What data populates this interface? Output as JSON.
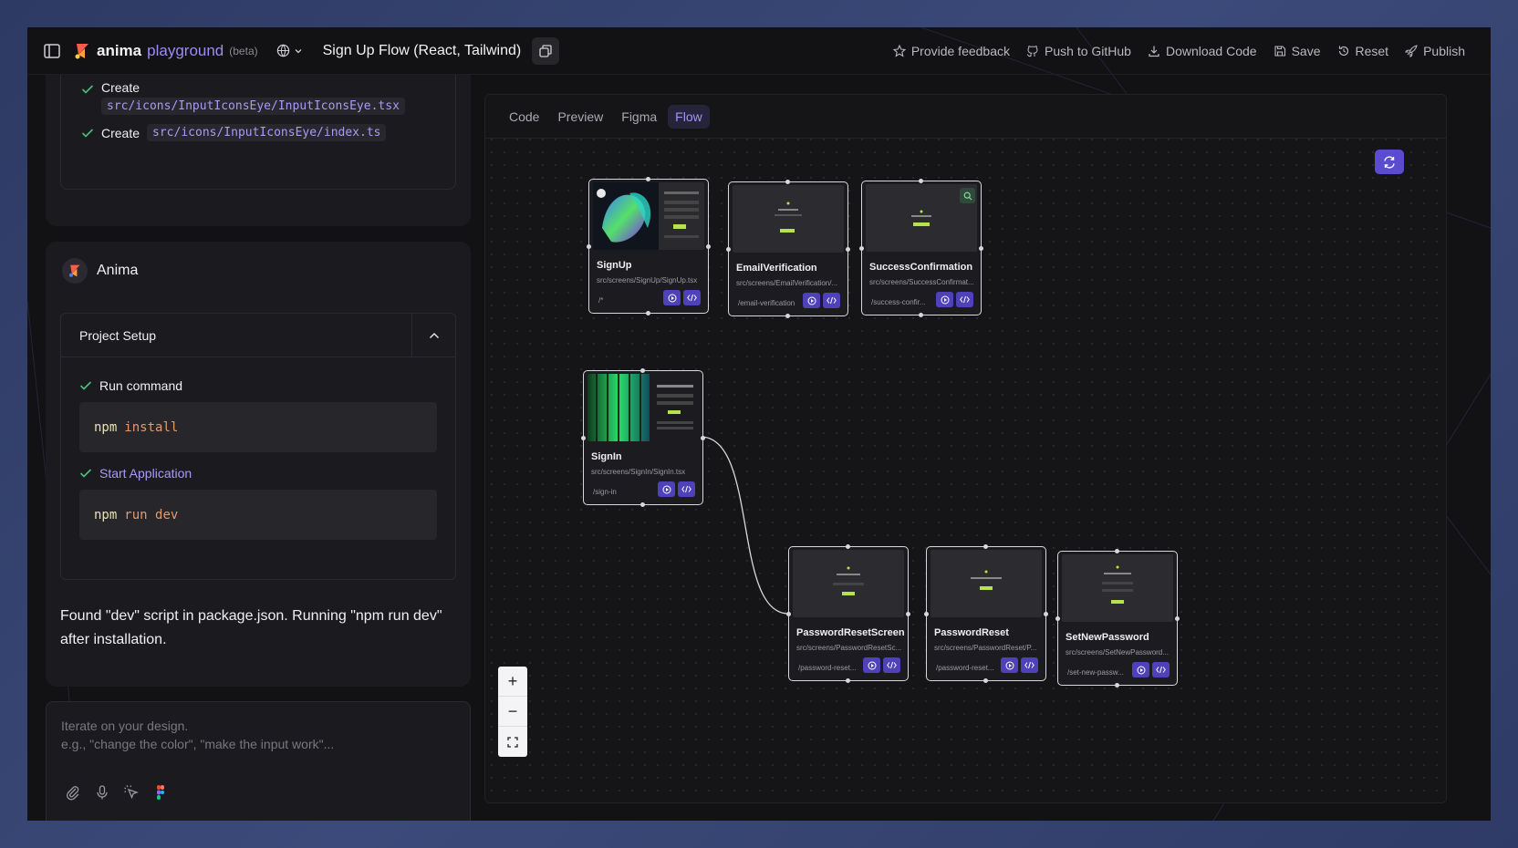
{
  "header": {
    "brand": "anima",
    "brand_sub": "playground",
    "beta": "(beta)",
    "project_title": "Sign Up Flow (React, Tailwind)",
    "actions": [
      {
        "label": "Provide feedback",
        "icon": "star-icon"
      },
      {
        "label": "Push to GitHub",
        "icon": "github-icon"
      },
      {
        "label": "Download Code",
        "icon": "download-icon"
      },
      {
        "label": "Save",
        "icon": "save-icon"
      },
      {
        "label": "Reset",
        "icon": "reset-icon"
      },
      {
        "label": "Publish",
        "icon": "rocket-icon"
      }
    ]
  },
  "files": [
    {
      "action": "Create",
      "path": "src/icons/InputIconsEye/InputIconsEye.tsx"
    },
    {
      "action": "Create",
      "path": "src/icons/InputIconsEye/index.ts"
    }
  ],
  "agent": {
    "name": "Anima",
    "setup_title": "Project Setup",
    "steps": [
      {
        "title": "Run command",
        "cmd": "npm",
        "arg": "install"
      },
      {
        "title": "Start Application",
        "cmd": "npm",
        "arg": "run dev"
      }
    ],
    "message": "Found \"dev\" script in package.json. Running \"npm run dev\" after installation."
  },
  "prompt": {
    "line1": "Iterate on your design.",
    "line2": "e.g., \"change the color\", \"make the input work\"..."
  },
  "tabs": [
    "Code",
    "Preview",
    "Figma",
    "Flow"
  ],
  "active_tab": "Flow",
  "nodes": [
    {
      "name": "SignUp",
      "path": "src/screens/SignUp/SignUp.tsx",
      "route": "/*"
    },
    {
      "name": "EmailVerification",
      "path": "src/screens/EmailVerification/...",
      "route": "/email-verification"
    },
    {
      "name": "SuccessConfirmation",
      "path": "src/screens/SuccessConfirmat...",
      "route": "/success-confir..."
    },
    {
      "name": "SignIn",
      "path": "src/screens/SignIn/SignIn.tsx",
      "route": "/sign-in"
    },
    {
      "name": "PasswordResetScreen",
      "path": "src/screens/PasswordResetSc...",
      "route": "/password-reset..."
    },
    {
      "name": "PasswordReset",
      "path": "src/screens/PasswordReset/P...",
      "route": "/password-reset..."
    },
    {
      "name": "SetNewPassword",
      "path": "src/screens/SetNewPassword...",
      "route": "/set-new-passw..."
    }
  ],
  "zoom": {
    "in": "+",
    "out": "−"
  },
  "colors": {
    "accent": "#9b8cf7",
    "button": "#4f41b9",
    "canvas": "#151517"
  }
}
